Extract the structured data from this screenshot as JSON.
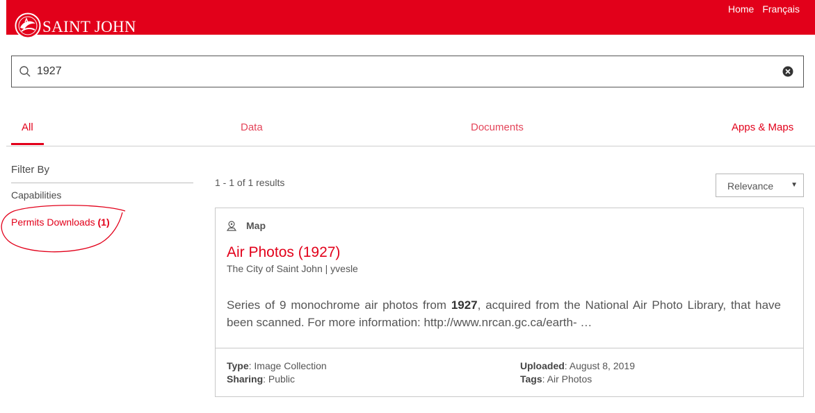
{
  "header": {
    "logo_text": "SAINT JOHN",
    "nav": [
      "Home",
      "Français"
    ],
    "colors": {
      "brand": "#e2001a",
      "text_on_brand": "#ffffff"
    }
  },
  "search": {
    "value": "1927",
    "icons": {
      "search": "search-icon",
      "clear": "clear-icon"
    }
  },
  "tabs": [
    {
      "label": "All",
      "active": true
    },
    {
      "label": "Data",
      "active": false
    },
    {
      "label": "Documents",
      "active": false
    },
    {
      "label": "Apps & Maps",
      "active": false
    }
  ],
  "filters": {
    "title": "Filter By",
    "capabilities_label": "Capabilities",
    "permits_label": "Permits Downloads",
    "permits_count": "(1)"
  },
  "results": {
    "count_text": "1 - 1 of 1 results",
    "sort_label": "Relevance"
  },
  "card": {
    "type_label": "Map",
    "title": "Air Photos (1927)",
    "owner": "The City of Saint John | yvesle",
    "desc_before": "Series of 9 monochrome air photos from ",
    "desc_bold": "1927",
    "desc_after": ", acquired from the National Air Photo Library, that have been scanned. For more information: http://www.nrcan.gc.ca/earth- …",
    "meta": {
      "type_key": "Type",
      "type_value": ": Image Collection",
      "sharing_key": "Sharing",
      "sharing_value": ": Public",
      "uploaded_key": "Uploaded",
      "uploaded_value": ": August 8, 2019",
      "tags_key": "Tags",
      "tags_value": ": Air Photos"
    }
  }
}
